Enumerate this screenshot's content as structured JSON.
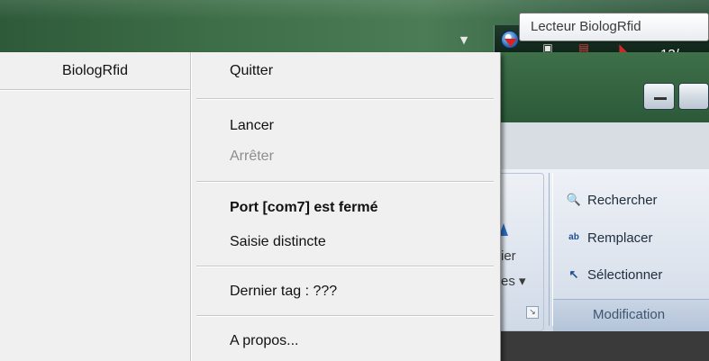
{
  "tooltip": {
    "text": "Lecteur BiologRfid"
  },
  "tray": {
    "clock_partial": "13/"
  },
  "menu": {
    "header": "BiologRfid",
    "items": [
      {
        "label": "Quitter",
        "enabled": true
      },
      {
        "label": "Lancer",
        "enabled": true
      },
      {
        "label": "Arrêter",
        "enabled": false
      },
      {
        "label": "Port [com7] est fermé",
        "enabled": true,
        "bold": true
      },
      {
        "label": "Saisie distincte",
        "enabled": true
      },
      {
        "label": "Dernier tag : ???",
        "enabled": true
      },
      {
        "label": "A propos...",
        "enabled": true
      }
    ]
  },
  "ribbon": {
    "left_group_text_1": "ier",
    "left_group_text_2": "es ▾",
    "items": [
      {
        "label": "Rechercher",
        "icon": "binoculars-icon"
      },
      {
        "label": "Remplacer",
        "icon": "replace-icon"
      },
      {
        "label": "Sélectionner",
        "icon": "cursor-icon"
      }
    ],
    "group_label": "Modification"
  }
}
